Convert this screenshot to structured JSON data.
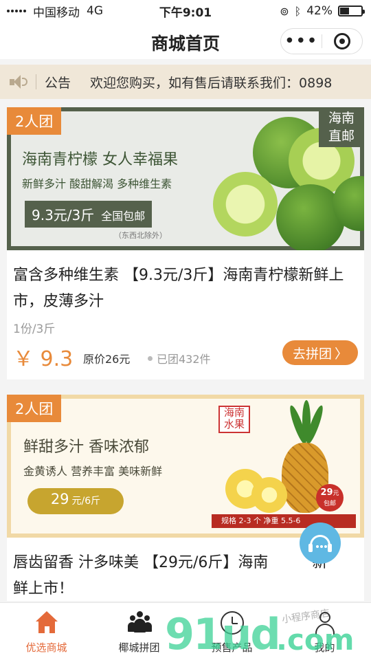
{
  "status_bar": {
    "carrier": "中国移动",
    "network": "4G",
    "time": "下午9:01",
    "battery_percent": "42%",
    "battery_level": 0.42
  },
  "navbar": {
    "title": "商城首页",
    "more_icon": "more-dots-icon",
    "close_icon": "close-target-icon"
  },
  "notice": {
    "icon": "speaker-icon",
    "label": "公告",
    "text": "欢迎您购买，如有售后请联系我们：0898"
  },
  "products": [
    {
      "group_tag": "2人团",
      "banner": {
        "headline": "海南青柠檬 女人幸福果",
        "sub": "新鲜多汁 酸甜解渴 多种维生素",
        "price_text": "9.3元/3斤",
        "shipping": "全国包邮",
        "note": "（东西北除外）",
        "corner_line1": "海南",
        "corner_line2": "直邮"
      },
      "name": "富含多种维生素 【9.3元/3斤】海南青柠檬新鲜上市，皮薄多汁",
      "spec": "1份/3斤",
      "price": "￥ 9.3",
      "original_price": "原价26元",
      "joined": "已团432件",
      "button": "去拼团",
      "button_icon": "chevron-right-icon"
    },
    {
      "group_tag": "2人团",
      "banner": {
        "headline": "鲜甜多汁 香味浓郁",
        "sub": "金黄诱人 营养丰富 美味新鲜",
        "price_value": "29",
        "price_unit": "元/6斤",
        "stamp_line1": "海南",
        "stamp_line2": "水果",
        "spec_bar": "规格 2-3 个  净重 5.5-6",
        "badge_value": "29",
        "badge_unit_small": "元",
        "badge_note": "包邮"
      },
      "name": "唇齿留香 汁多味美 【29元/6斤】海南",
      "name_tail": "新",
      "name_line2": "鲜上市！"
    }
  ],
  "floating_service": {
    "icon": "customer-service-icon"
  },
  "tabbar": {
    "items": [
      {
        "label": "优选商城",
        "icon": "home-icon",
        "active": true
      },
      {
        "label": "椰城拼团",
        "icon": "group-people-icon",
        "active": false
      },
      {
        "label": "预售产品",
        "icon": "clock-icon",
        "active": false
      },
      {
        "label": "我的",
        "icon": "user-icon",
        "active": false
      }
    ]
  },
  "watermark": {
    "main": "91ud",
    "suffix": ".com",
    "script": "小程序商店"
  },
  "colors": {
    "accent": "#e88a3a",
    "active_tab": "#e46a3a",
    "notice_bg": "#f0e7d8",
    "lime_frame": "#55614c",
    "service_blue": "#5fb8e3"
  }
}
